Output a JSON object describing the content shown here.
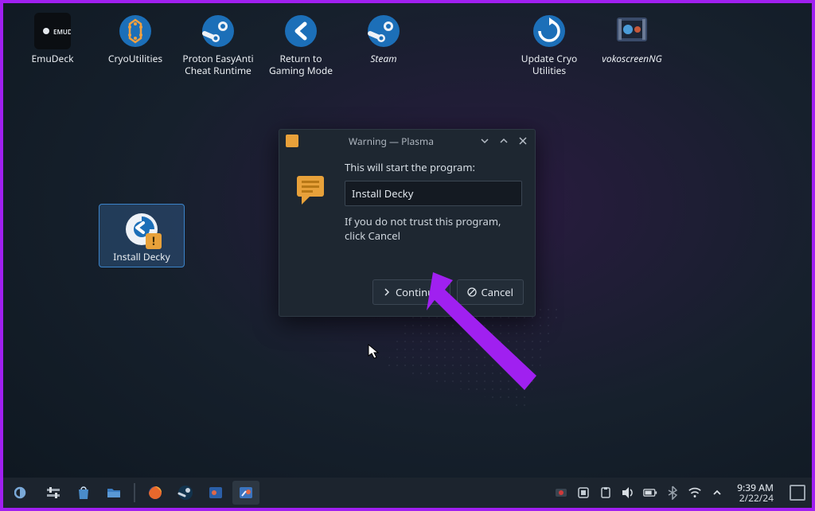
{
  "desktop": {
    "icons": [
      {
        "label": "EmuDeck"
      },
      {
        "label": "CryoUtilities"
      },
      {
        "label": "Proton EasyAnti Cheat Runtime"
      },
      {
        "label": "Return to Gaming Mode"
      },
      {
        "label": "Steam",
        "italic": true
      },
      {
        "label": "Update Cryo Utilities"
      },
      {
        "label": "vokoscreenNG",
        "italic": true
      }
    ],
    "selected_icon": {
      "label": "Install Decky"
    }
  },
  "dialog": {
    "title": "Warning — Plasma",
    "msg_top": "This will start the program:",
    "program_name": "Install Decky",
    "msg_bottom": "If you do not trust this program, click Cancel",
    "continue_label": "Continue",
    "cancel_label": "Cancel"
  },
  "taskbar": {
    "time": "9:39 AM",
    "date": "2/22/24"
  }
}
